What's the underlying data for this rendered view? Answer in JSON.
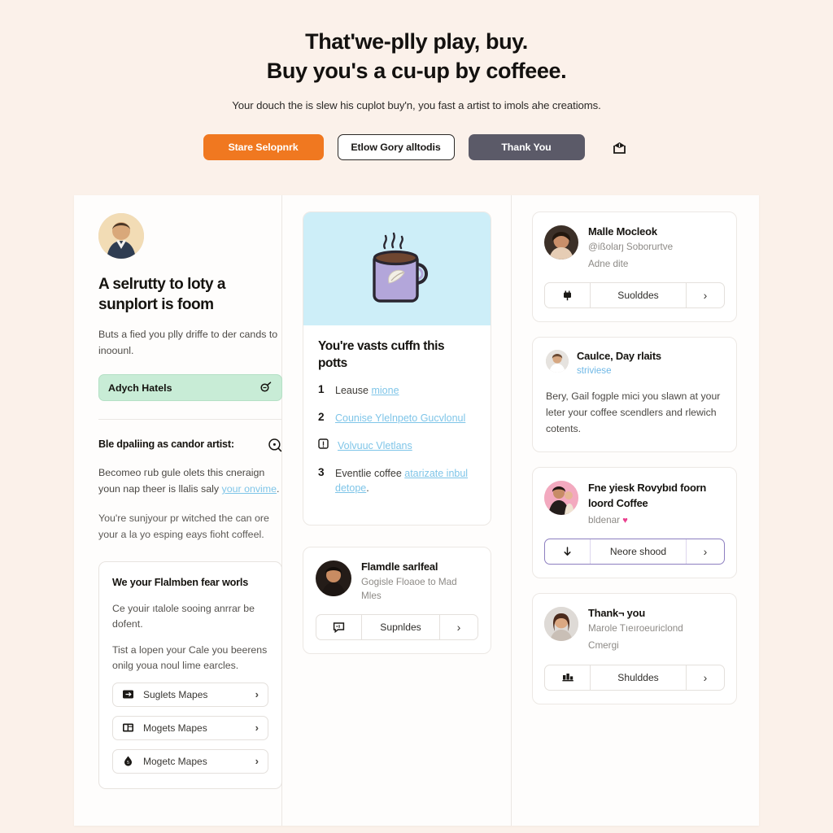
{
  "hero": {
    "title_line1": "That'we-plly play, buy.",
    "title_line2": "Buy you's a cu-up by coffeee.",
    "subtitle": "Your douch the is slew his cuplot buy'n, you fast a artist to imols ahe creatioms."
  },
  "actions": {
    "primary_label": "Stare Selopnrk",
    "outline_label": "Etlow Gory alltodis",
    "dark_label": "Thank You",
    "share_icon": "share-box-icon"
  },
  "left": {
    "avatar_name": "profile-avatar",
    "headline": "A selrutty to loty a sunplort is foom",
    "body": "Buts a fied you plly driffe to der cands to inoounl.",
    "field_label": "Adych Hatels",
    "field_icon": "search-loop-icon",
    "section_title": "Ble dpaliing as candor artist:",
    "section_icon": "magnifier-icon",
    "para1_a": "Becomeo гub ɡule olets this cneraign youn nap theer is llalis salу",
    "para1_link": "your onvime",
    "para1_b": ".",
    "para2": "You're sunjyour pr witched the can ore your a la yo espinɡ eays fioht coffeel.",
    "subcard": {
      "title": "We your Flalmben fear worls",
      "p1": "Ce youir ıtalole sooing anrrar be dofent.",
      "p2": "Tist a lopen your Cale you beerens onilg youa noul lime earcles.",
      "rows": [
        {
          "icon": "export-box-icon",
          "label": "Suglets Mapes",
          "chevron": "›"
        },
        {
          "icon": "book-icon",
          "label": "Mogets Mapes",
          "chevron": "›"
        },
        {
          "icon": "drop-icon",
          "label": "Mogetc Mapes",
          "chevron": "›"
        }
      ]
    }
  },
  "middle": {
    "illustration": "coffee-mug-illustration",
    "illustration_bg": "#cdeef8",
    "mug_color": "#b3a6da",
    "card_title": "You're vasts cuffn this potts",
    "list": [
      {
        "num": "1",
        "text": "Leause ",
        "link": "mione",
        "tail": ""
      },
      {
        "num": "2",
        "text": "",
        "link": "Counise Ylelnpeto Gucvlonul",
        "tail": ""
      },
      {
        "num": "icon:note-icon",
        "text": "",
        "link": "Volvuuc Vletlans",
        "tail": ""
      },
      {
        "num": "3",
        "text": "Eventlie coffee ",
        "link": "atarizate inbul detope",
        "tail": "."
      }
    ],
    "person": {
      "avatar_name": "person-avatar",
      "name": "Flamdle sarlfeal",
      "meta": "Gogisle Floaoe to Mad Mles",
      "btn_icon": "chat-icon",
      "btn_label": "Supnldes",
      "btn_chevron": "›"
    }
  },
  "right": {
    "cards": [
      {
        "type": "person",
        "avatar_name": "maile-avatar",
        "name": "Malle Mocleok",
        "meta1": "@ißolarȷ Soborurtve",
        "meta2": "Adne dite",
        "btn_icon": "plug-icon",
        "btn_label": "Suolddes",
        "btn_chevron": "›"
      },
      {
        "type": "quote",
        "avatar_name": "cauloe-avatar",
        "title": "Caulce, Day rlaits",
        "sub": "striviese",
        "body": "Bery, Gail foɡple mici you slawn at your leter your coffee scendlers and rlewich cotents."
      },
      {
        "type": "person",
        "avatar_name": "royal-avatar",
        "name": "Fne yiesk Rovybıd foorn loord Coffee",
        "meta1": "bldenar",
        "heart": "♥",
        "accent": "#8d7fc0",
        "btn_icon": "download-arrow-icon",
        "btn_label": "Neore shood",
        "btn_chevron": "›"
      },
      {
        "type": "person",
        "avatar_name": "thanks-avatar",
        "name": "Thank¬ you",
        "meta1": "Marole Tıeıroeuriclond",
        "meta2": "Cmergi",
        "btn_icon": "bars-icon",
        "btn_label": "Shulddes",
        "btn_chevron": "›"
      }
    ]
  }
}
